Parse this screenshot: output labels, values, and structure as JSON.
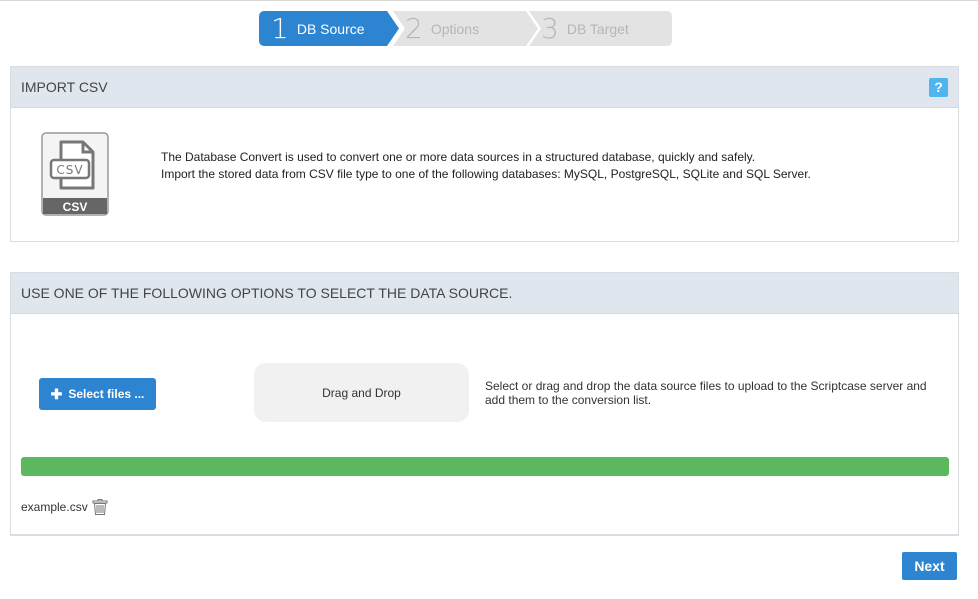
{
  "wizard": {
    "steps": [
      {
        "num": "1",
        "label": "DB Source"
      },
      {
        "num": "2",
        "label": "Options"
      },
      {
        "num": "3",
        "label": "DB Target"
      }
    ]
  },
  "import_panel": {
    "title": "IMPORT CSV",
    "help_label": "?",
    "icon_text": "CSV",
    "description_line1": "The Database Convert is used to convert one or more data sources in a structured database, quickly and safely.",
    "description_line2": "Import the stored data from CSV file type to one of the following databases: MySQL, PostgreSQL, SQLite and SQL Server."
  },
  "source_panel": {
    "title": "USE ONE OF THE FOLLOWING OPTIONS TO SELECT THE DATA SOURCE.",
    "select_button": "Select files ...",
    "drop_zone": "Drag and Drop",
    "hint": "Select or drag and drop the data source files to upload to the Scriptcase server and add them to the conversion list.",
    "upload_progress": 1.0,
    "file_name": "example.csv"
  },
  "footer": {
    "next_label": "Next"
  },
  "colors": {
    "primary": "#2d84d0",
    "progress": "#5cb85c",
    "panel_header": "#e0e6ee",
    "help": "#4fb5ee"
  }
}
